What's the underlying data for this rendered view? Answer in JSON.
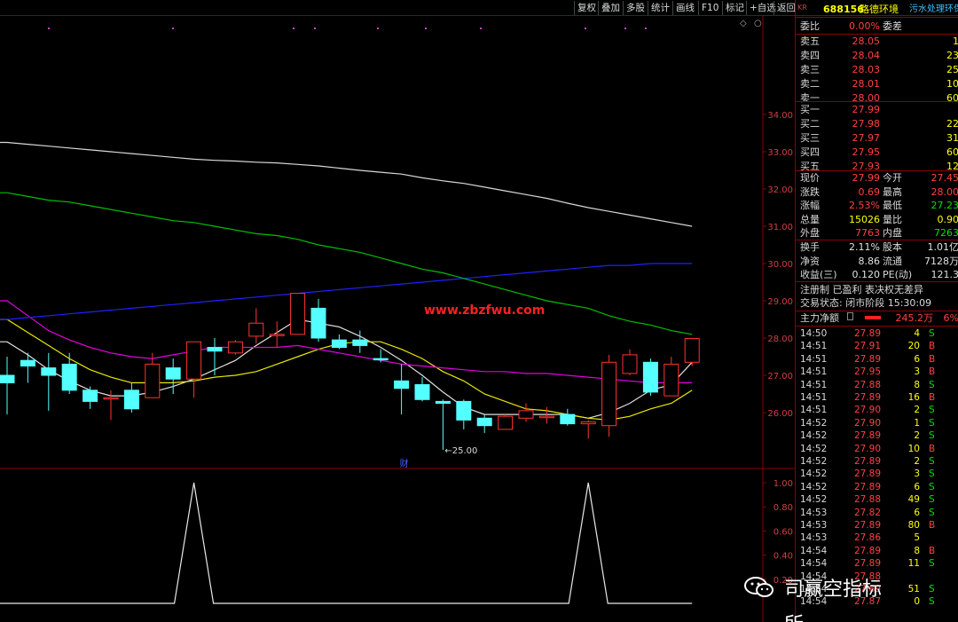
{
  "toolbar": {
    "buttons": [
      "复权",
      "叠加",
      "多股",
      "统计",
      "画线",
      "F10",
      "标记",
      "+自选",
      "返回"
    ]
  },
  "website_watermark": "www.zbzfwu.com",
  "wechat_watermark": "司赢空指标所",
  "chart_data": {
    "type": "candlestick",
    "price_axis": {
      "ticks": [
        26.0,
        27.0,
        28.0,
        29.0,
        30.0,
        31.0,
        32.0,
        33.0,
        34.0
      ],
      "ylim": [
        25.0,
        35.0
      ]
    },
    "indicator_axis": {
      "ticks": [
        0.2,
        0.4,
        0.6,
        0.8,
        1.0
      ],
      "ylim": [
        0.0,
        1.1
      ]
    },
    "candles": [
      {
        "o": 27.0,
        "c": 26.8,
        "h": 27.5,
        "l": 25.95
      },
      {
        "o": 27.4,
        "c": 27.25,
        "h": 27.6,
        "l": 26.8
      },
      {
        "o": 27.2,
        "c": 27.0,
        "h": 27.6,
        "l": 26.05
      },
      {
        "o": 27.3,
        "c": 26.6,
        "h": 27.6,
        "l": 26.5
      },
      {
        "o": 26.6,
        "c": 26.3,
        "h": 26.7,
        "l": 26.1
      },
      {
        "o": 26.4,
        "c": 26.4,
        "h": 26.6,
        "l": 25.8
      },
      {
        "o": 26.6,
        "c": 26.1,
        "h": 26.8,
        "l": 26.0
      },
      {
        "o": 26.4,
        "c": 27.3,
        "h": 27.6,
        "l": 26.4
      },
      {
        "o": 27.2,
        "c": 26.9,
        "h": 27.45,
        "l": 26.5
      },
      {
        "o": 26.9,
        "c": 27.9,
        "h": 27.9,
        "l": 26.4
      },
      {
        "o": 27.75,
        "c": 27.65,
        "h": 28.0,
        "l": 27.0
      },
      {
        "o": 27.6,
        "c": 27.9,
        "h": 27.95,
        "l": 27.55
      },
      {
        "o": 28.05,
        "c": 28.4,
        "h": 28.8,
        "l": 27.85
      },
      {
        "o": 28.1,
        "c": 28.1,
        "h": 28.45,
        "l": 27.75
      },
      {
        "o": 28.1,
        "c": 29.2,
        "h": 29.2,
        "l": 28.1
      },
      {
        "o": 28.8,
        "c": 28.0,
        "h": 29.05,
        "l": 27.9
      },
      {
        "o": 27.95,
        "c": 27.75,
        "h": 28.1,
        "l": 27.7
      },
      {
        "o": 27.95,
        "c": 27.8,
        "h": 28.2,
        "l": 27.6
      },
      {
        "o": 27.45,
        "c": 27.42,
        "h": 27.7,
        "l": 27.35
      },
      {
        "o": 26.85,
        "c": 26.65,
        "h": 27.3,
        "l": 25.95
      },
      {
        "o": 26.75,
        "c": 26.35,
        "h": 26.95,
        "l": 26.3
      },
      {
        "o": 26.3,
        "c": 26.25,
        "h": 26.35,
        "l": 25.0
      },
      {
        "o": 26.3,
        "c": 25.8,
        "h": 26.35,
        "l": 25.55
      },
      {
        "o": 25.85,
        "c": 25.65,
        "h": 25.95,
        "l": 25.45
      },
      {
        "o": 25.55,
        "c": 25.9,
        "h": 25.95,
        "l": 25.55
      },
      {
        "o": 25.85,
        "c": 26.05,
        "h": 26.25,
        "l": 25.75
      },
      {
        "o": 25.9,
        "c": 25.9,
        "h": 26.15,
        "l": 25.7
      },
      {
        "o": 25.95,
        "c": 25.7,
        "h": 26.1,
        "l": 25.65
      },
      {
        "o": 25.7,
        "c": 25.75,
        "h": 25.8,
        "l": 25.3
      },
      {
        "o": 25.65,
        "c": 27.35,
        "h": 27.55,
        "l": 25.35
      },
      {
        "o": 27.05,
        "c": 27.55,
        "h": 27.7,
        "l": 27.0
      },
      {
        "o": 27.35,
        "c": 26.55,
        "h": 27.45,
        "l": 26.45
      },
      {
        "o": 26.45,
        "c": 27.3,
        "h": 27.5,
        "l": 26.45
      },
      {
        "o": 27.35,
        "c": 27.99,
        "h": 28.0,
        "l": 27.25
      }
    ],
    "low_label": "25.00",
    "event_marker": "财",
    "ma_lines": [
      {
        "color": "#e0e0e0",
        "values": [
          27.9,
          27.55,
          27.15,
          26.85,
          26.6,
          26.45,
          26.45,
          26.55,
          26.7,
          26.9,
          27.15,
          27.4,
          27.8,
          28.15,
          28.5,
          28.4,
          28.3,
          28.05,
          27.75,
          27.4,
          27.0,
          26.55,
          26.15,
          25.95,
          25.95,
          25.95,
          25.95,
          25.95,
          25.85,
          26.0,
          26.25,
          26.6,
          26.75,
          27.35
        ]
      },
      {
        "color": "#e8e800",
        "values": [
          28.5,
          28.15,
          27.8,
          27.45,
          27.15,
          26.95,
          26.8,
          26.8,
          26.8,
          26.85,
          26.95,
          27.0,
          27.1,
          27.3,
          27.5,
          27.7,
          27.85,
          27.9,
          27.9,
          27.7,
          27.45,
          27.1,
          26.85,
          26.5,
          26.3,
          26.1,
          26.05,
          25.95,
          25.85,
          25.8,
          25.9,
          26.1,
          26.25,
          26.6
        ]
      },
      {
        "color": "#e000e0",
        "values": [
          29.0,
          28.6,
          28.2,
          27.95,
          27.75,
          27.6,
          27.5,
          27.45,
          27.55,
          27.65,
          27.75,
          27.75,
          27.75,
          27.75,
          27.8,
          27.7,
          27.6,
          27.5,
          27.4,
          27.3,
          27.25,
          27.2,
          27.15,
          27.1,
          27.1,
          27.05,
          27.05,
          27.0,
          26.95,
          26.9,
          26.85,
          26.8,
          26.8,
          26.8
        ]
      },
      {
        "color": "#2020ff",
        "values": [
          28.5,
          28.55,
          28.6,
          28.65,
          28.7,
          28.75,
          28.8,
          28.85,
          28.9,
          28.95,
          29.0,
          29.05,
          29.1,
          29.15,
          29.2,
          29.25,
          29.3,
          29.35,
          29.4,
          29.45,
          29.5,
          29.55,
          29.6,
          29.65,
          29.7,
          29.75,
          29.8,
          29.85,
          29.9,
          29.95,
          29.95,
          30.0,
          30.0,
          30.0
        ]
      },
      {
        "color": "#00c000",
        "values": [
          31.9,
          31.8,
          31.7,
          31.65,
          31.55,
          31.45,
          31.35,
          31.25,
          31.15,
          31.1,
          31.0,
          30.9,
          30.8,
          30.75,
          30.65,
          30.5,
          30.4,
          30.3,
          30.15,
          30.0,
          29.85,
          29.75,
          29.6,
          29.45,
          29.3,
          29.15,
          29.0,
          28.9,
          28.8,
          28.6,
          28.45,
          28.35,
          28.2,
          28.1
        ]
      },
      {
        "color": "#d8d8d8",
        "values": [
          33.25,
          33.2,
          33.15,
          33.1,
          33.05,
          33.0,
          32.95,
          32.9,
          32.85,
          32.8,
          32.77,
          32.75,
          32.72,
          32.7,
          32.66,
          32.62,
          32.56,
          32.5,
          32.45,
          32.4,
          32.3,
          32.22,
          32.15,
          32.05,
          31.95,
          31.85,
          31.75,
          31.62,
          31.5,
          31.4,
          31.3,
          31.2,
          31.1,
          31.0
        ]
      }
    ],
    "indicator_values": [
      0,
      0,
      0,
      0,
      0,
      0,
      0,
      0,
      0,
      1,
      0,
      0,
      0,
      0,
      0,
      0,
      0,
      0,
      0,
      0,
      0,
      0,
      0,
      0,
      0,
      0,
      0,
      0,
      1,
      0,
      0,
      0,
      0,
      0
    ]
  },
  "quote": {
    "stock_code": "688156",
    "stock_name": "路德环境",
    "kr_badge": "KR",
    "industry": "污水处理环保共",
    "weibi_label": "委比",
    "weibi_value": "0.00%",
    "weicha_label": "委差",
    "sell": [
      {
        "label": "卖五",
        "price": "28.05",
        "vol": "1"
      },
      {
        "label": "卖四",
        "price": "28.04",
        "vol": "23"
      },
      {
        "label": "卖三",
        "price": "28.03",
        "vol": "25"
      },
      {
        "label": "卖二",
        "price": "28.01",
        "vol": "10"
      },
      {
        "label": "卖一",
        "price": "28.00",
        "vol": "60"
      }
    ],
    "buy": [
      {
        "label": "买一",
        "price": "27.99",
        "vol": ""
      },
      {
        "label": "买二",
        "price": "27.98",
        "vol": "22"
      },
      {
        "label": "买三",
        "price": "27.97",
        "vol": "31"
      },
      {
        "label": "买四",
        "price": "27.95",
        "vol": "60"
      },
      {
        "label": "买五",
        "price": "27.93",
        "vol": "12"
      }
    ],
    "stats": [
      {
        "l1": "现价",
        "v1": "27.99",
        "c1": "red",
        "l2": "今开",
        "v2": "27.45",
        "c2": "red"
      },
      {
        "l1": "涨跌",
        "v1": "0.69",
        "c1": "red",
        "l2": "最高",
        "v2": "28.00",
        "c2": "red"
      },
      {
        "l1": "涨幅",
        "v1": "2.53%",
        "c1": "red",
        "l2": "最低",
        "v2": "27.23",
        "c2": "green"
      },
      {
        "l1": "总量",
        "v1": "15026",
        "c1": "yellow",
        "l2": "量比",
        "v2": "0.90",
        "c2": "yellow"
      },
      {
        "l1": "外盘",
        "v1": "7763",
        "c1": "red",
        "l2": "内盘",
        "v2": "7263",
        "c2": "green"
      }
    ],
    "stats2": [
      {
        "l1": "换手",
        "v1": "2.11%",
        "l2": "股本",
        "v2": "1.01亿"
      },
      {
        "l1": "净资",
        "v1": "8.86",
        "l2": "流通",
        "v2": "7128万"
      },
      {
        "l1": "收益(三)",
        "v1": "0.120",
        "l2": "PE(动)",
        "v2": "121.3"
      }
    ],
    "registration": "注册制 已盈利 表决权无差异",
    "trade_status": "交易状态: 闭市阶段 15:30:09",
    "main_flow_label": "主力净额",
    "main_flow_value": "245.2万",
    "main_flow_pct": "6%",
    "ticks": [
      {
        "t": "14:50",
        "p": "27.89",
        "v": "4",
        "d": "S"
      },
      {
        "t": "14:51",
        "p": "27.91",
        "v": "20",
        "d": "B"
      },
      {
        "t": "14:51",
        "p": "27.89",
        "v": "6",
        "d": "B"
      },
      {
        "t": "14:51",
        "p": "27.95",
        "v": "3",
        "d": "B"
      },
      {
        "t": "14:51",
        "p": "27.88",
        "v": "8",
        "d": "S"
      },
      {
        "t": "14:51",
        "p": "27.89",
        "v": "16",
        "d": "B"
      },
      {
        "t": "14:51",
        "p": "27.90",
        "v": "2",
        "d": "S"
      },
      {
        "t": "14:52",
        "p": "27.90",
        "v": "1",
        "d": "S"
      },
      {
        "t": "14:52",
        "p": "27.89",
        "v": "2",
        "d": "S"
      },
      {
        "t": "14:52",
        "p": "27.90",
        "v": "10",
        "d": "B"
      },
      {
        "t": "14:52",
        "p": "27.89",
        "v": "2",
        "d": "S"
      },
      {
        "t": "14:52",
        "p": "27.89",
        "v": "3",
        "d": "S"
      },
      {
        "t": "14:52",
        "p": "27.89",
        "v": "6",
        "d": "S"
      },
      {
        "t": "14:52",
        "p": "27.88",
        "v": "49",
        "d": "S"
      },
      {
        "t": "14:53",
        "p": "27.82",
        "v": "6",
        "d": "S"
      },
      {
        "t": "14:53",
        "p": "27.89",
        "v": "80",
        "d": "B"
      },
      {
        "t": "14:53",
        "p": "27.86",
        "v": "5",
        "d": ""
      },
      {
        "t": "14:54",
        "p": "27.89",
        "v": "8",
        "d": "B"
      },
      {
        "t": "14:54",
        "p": "27.89",
        "v": "11",
        "d": "S"
      },
      {
        "t": "14:54",
        "p": "27.88",
        "v": "",
        "d": ""
      },
      {
        "t": "14:54",
        "p": "27.89",
        "v": "51",
        "d": "S"
      },
      {
        "t": "14:54",
        "p": "27.87",
        "v": "0",
        "d": "S"
      }
    ]
  }
}
